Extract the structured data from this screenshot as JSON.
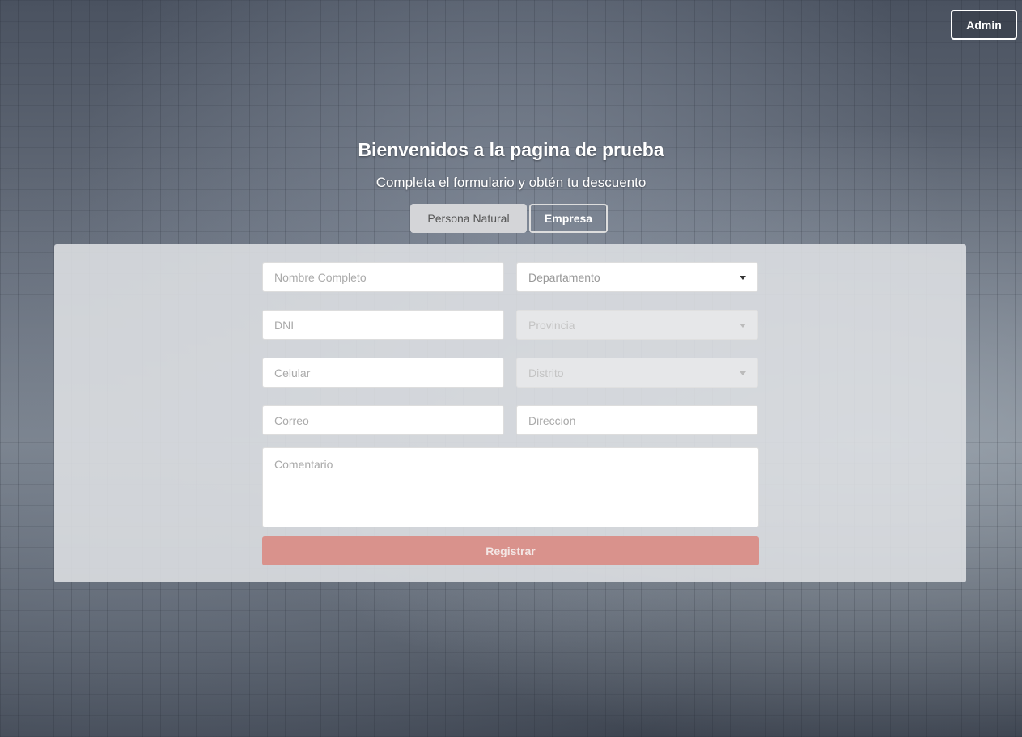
{
  "header": {
    "admin_label": "Admin",
    "title": "Bienvenidos a la pagina de prueba",
    "subtitle": "Completa el formulario y obtén tu descuento"
  },
  "tabs": [
    {
      "label": "Persona Natural",
      "active": true
    },
    {
      "label": "Empresa",
      "active": false
    }
  ],
  "form": {
    "nombre": "Nombre Completo",
    "dni": "DNI",
    "celular": "Celular",
    "correo": "Correo",
    "departamento": "Departamento",
    "provincia": "Provincia",
    "distrito": "Distrito",
    "direccion": "Direccion",
    "comentario": "Comentario",
    "submit_label": "Registrar"
  },
  "colors": {
    "submit": "#d9928c",
    "panel": "#dee0e4"
  }
}
